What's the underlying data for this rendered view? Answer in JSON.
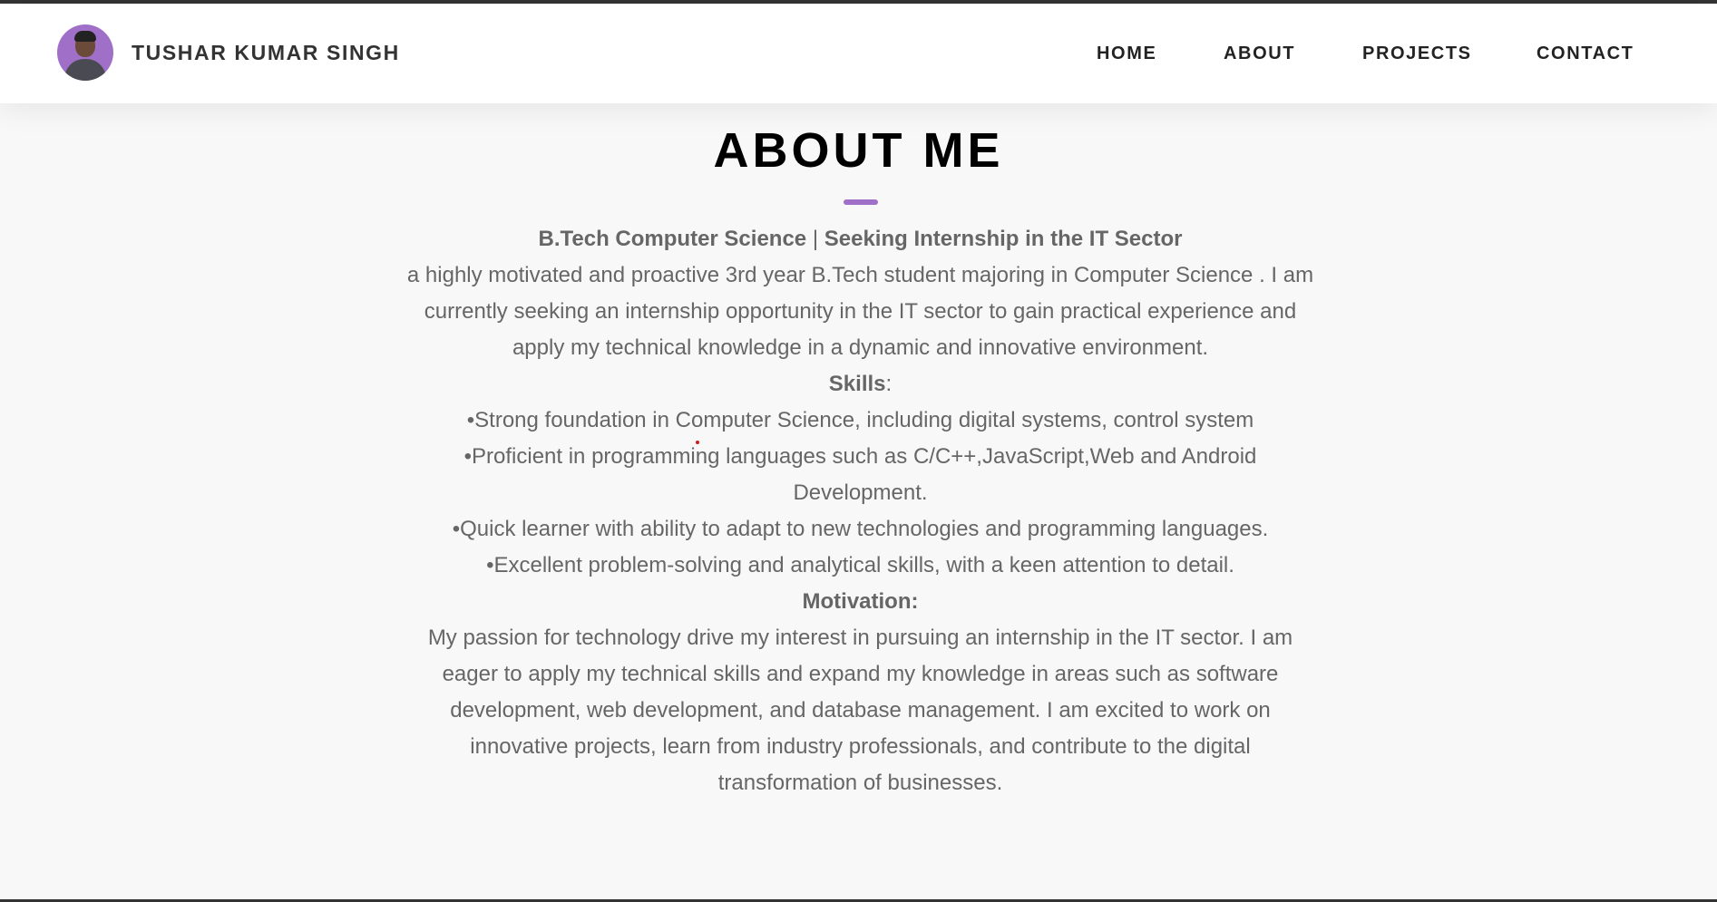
{
  "header": {
    "brand_name": "TUSHAR KUMAR SINGH",
    "avatar_icon": "profile-photo",
    "nav": [
      {
        "label": "HOME"
      },
      {
        "label": "ABOUT"
      },
      {
        "label": "PROJECTS"
      },
      {
        "label": "CONTACT"
      }
    ]
  },
  "about": {
    "title": "ABOUT ME",
    "headline_part1": "B.Tech Computer Science",
    "headline_sep": " | ",
    "headline_part2": "Seeking Internship in the IT Sector",
    "intro": "a highly motivated and proactive 3rd year B.Tech student majoring in Computer Science . I am currently seeking an internship opportunity in the IT sector to gain practical experience and apply my technical knowledge in a dynamic and innovative environment.",
    "skills_heading": "Skills",
    "skills_colon": ":",
    "skills": [
      "•Strong foundation in Computer Science, including digital systems, control system",
      "•Proficient in programming languages such as C/C++,JavaScript,Web and Android Development.",
      "•Quick learner with ability to adapt to new technologies and programming languages.",
      "•Excellent problem-solving and analytical skills, with a keen attention to detail."
    ],
    "motivation_heading": "Motivation:",
    "motivation": "My passion for technology drive my interest in pursuing an internship in the IT sector. I am eager to apply my technical skills and expand my knowledge in areas such as software development, web development, and database management. I am excited to work on innovative projects, learn from industry professionals, and contribute to the digital transformation of businesses."
  },
  "colors": {
    "accent": "#a070c8",
    "text_muted": "#666666",
    "heading": "#000000",
    "border": "#333333"
  }
}
